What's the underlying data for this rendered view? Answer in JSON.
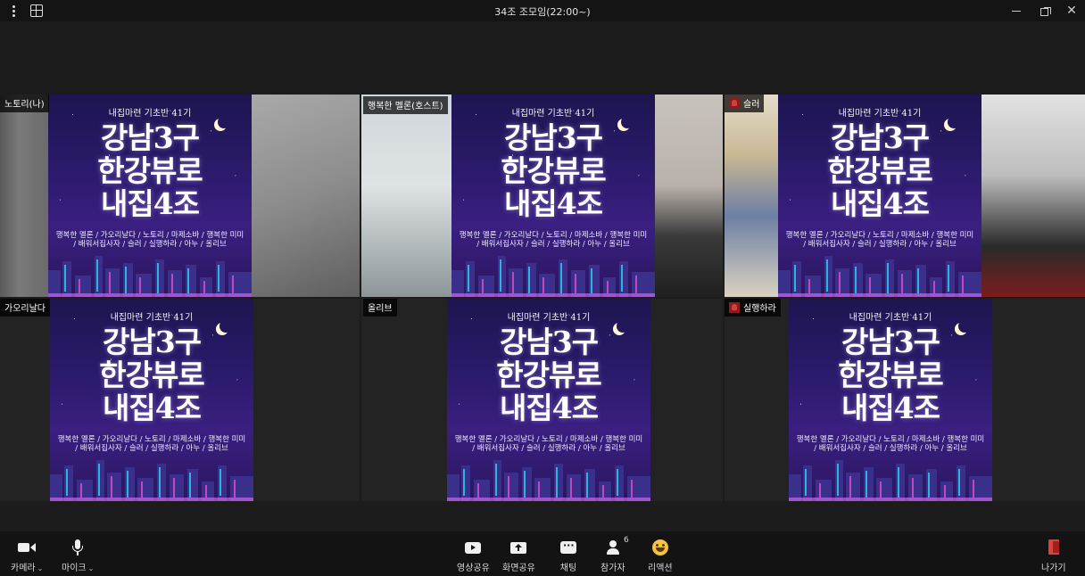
{
  "titlebar": {
    "title": "34조 조모임(22:00~)"
  },
  "poster": {
    "subtitle": "내집마련 기초반 41기",
    "line1": "강남3구",
    "line2": "한강뷰로",
    "line3": "내집4조",
    "members": "행복한 멜론 / 가오리날다 / 노토리 / 마제소바 / 행복한 미미 / 배워서집사자 / 슬러 / 실행하라 / 아누 / 올리브"
  },
  "participants": [
    {
      "name": "노토리(나)"
    },
    {
      "name": "행복한 멜론(호스트)",
      "host": true
    },
    {
      "name": "슬러"
    },
    {
      "name": "가오리날다"
    },
    {
      "name": "올리브"
    },
    {
      "name": "실행하라"
    }
  ],
  "toolbar": {
    "camera": "카메라",
    "mic": "마이크",
    "video_share": "영상공유",
    "screen_share": "화면공유",
    "chat": "채팅",
    "participants": "참가자",
    "participant_count": "6",
    "reaction": "리액션",
    "leave": "나가기"
  },
  "colors": {
    "host_border": "#23c7a0",
    "leave": "#e0403d",
    "poster_bg": "#2a1a6a"
  }
}
